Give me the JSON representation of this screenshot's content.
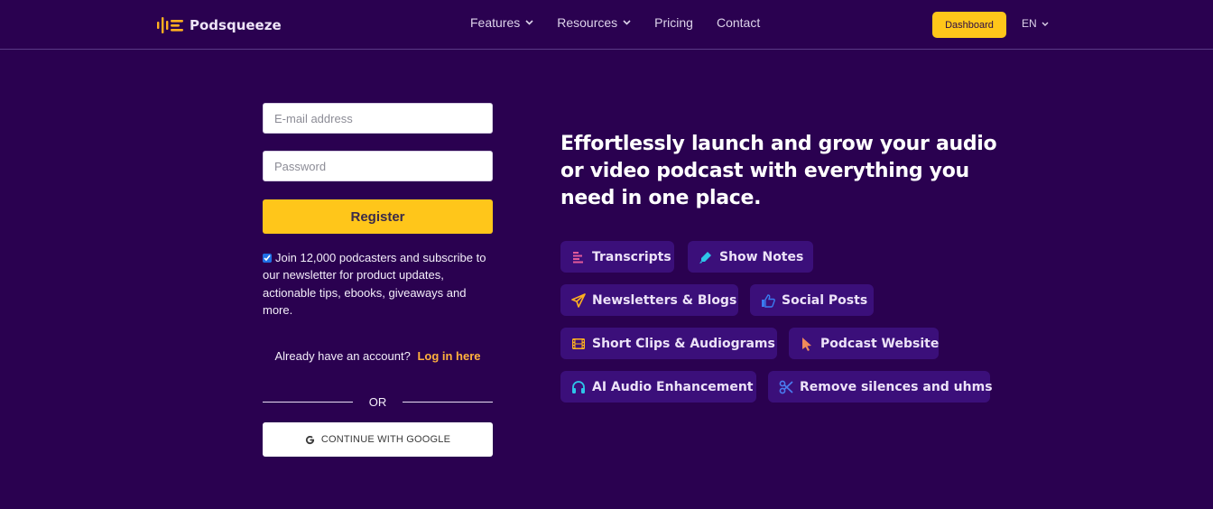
{
  "header": {
    "brand": "Podsqueeze",
    "nav": [
      {
        "label": "Features",
        "has_dropdown": true
      },
      {
        "label": "Resources",
        "has_dropdown": true
      },
      {
        "label": "Pricing",
        "has_dropdown": false
      },
      {
        "label": "Contact",
        "has_dropdown": false
      }
    ],
    "dashboard_label": "Dashboard",
    "language": "EN"
  },
  "form": {
    "email": {
      "value": "",
      "placeholder": "E-mail address"
    },
    "password": {
      "value": "",
      "placeholder": "Password"
    },
    "register_label": "Register",
    "newsletter_checked": true,
    "newsletter_text": "Join 12,000 podcasters and subscribe to our newsletter for product updates, actionable tips, ebooks, giveaways and more.",
    "login_prompt": "Already have an account?",
    "login_link": "Log in here",
    "divider_text": "OR",
    "google_label": "CONTINUE WITH GOOGLE"
  },
  "hero": {
    "headline": "Effortlessly launch and grow your audio or video podcast with everything you need in one place."
  },
  "features": [
    {
      "label": "Transcripts",
      "icon": "lines-icon",
      "color": "#e25a9a"
    },
    {
      "label": "Show Notes",
      "icon": "highlighter-icon",
      "color": "#2ec5e8"
    },
    {
      "label": "Newsletters & Blogs",
      "icon": "paper-plane-icon",
      "color": "#ffb020"
    },
    {
      "label": "Social Posts",
      "icon": "thumbs-up-icon",
      "color": "#3a7bf0"
    },
    {
      "label": "Short Clips & Audiograms",
      "icon": "film-icon",
      "color": "#ffb020"
    },
    {
      "label": "Podcast Website",
      "icon": "cursor-icon",
      "color": "#f08a5a"
    },
    {
      "label": "AI Audio Enhancement",
      "icon": "headphones-icon",
      "color": "#2ec5e8"
    },
    {
      "label": "Remove silences and uhms",
      "icon": "scissors-icon",
      "color": "#4a7cf0"
    }
  ],
  "colors": {
    "background": "#2a0150",
    "accent": "#ffc61a",
    "link": "#ffb13d",
    "chip_bg": "#3b0f7a"
  }
}
